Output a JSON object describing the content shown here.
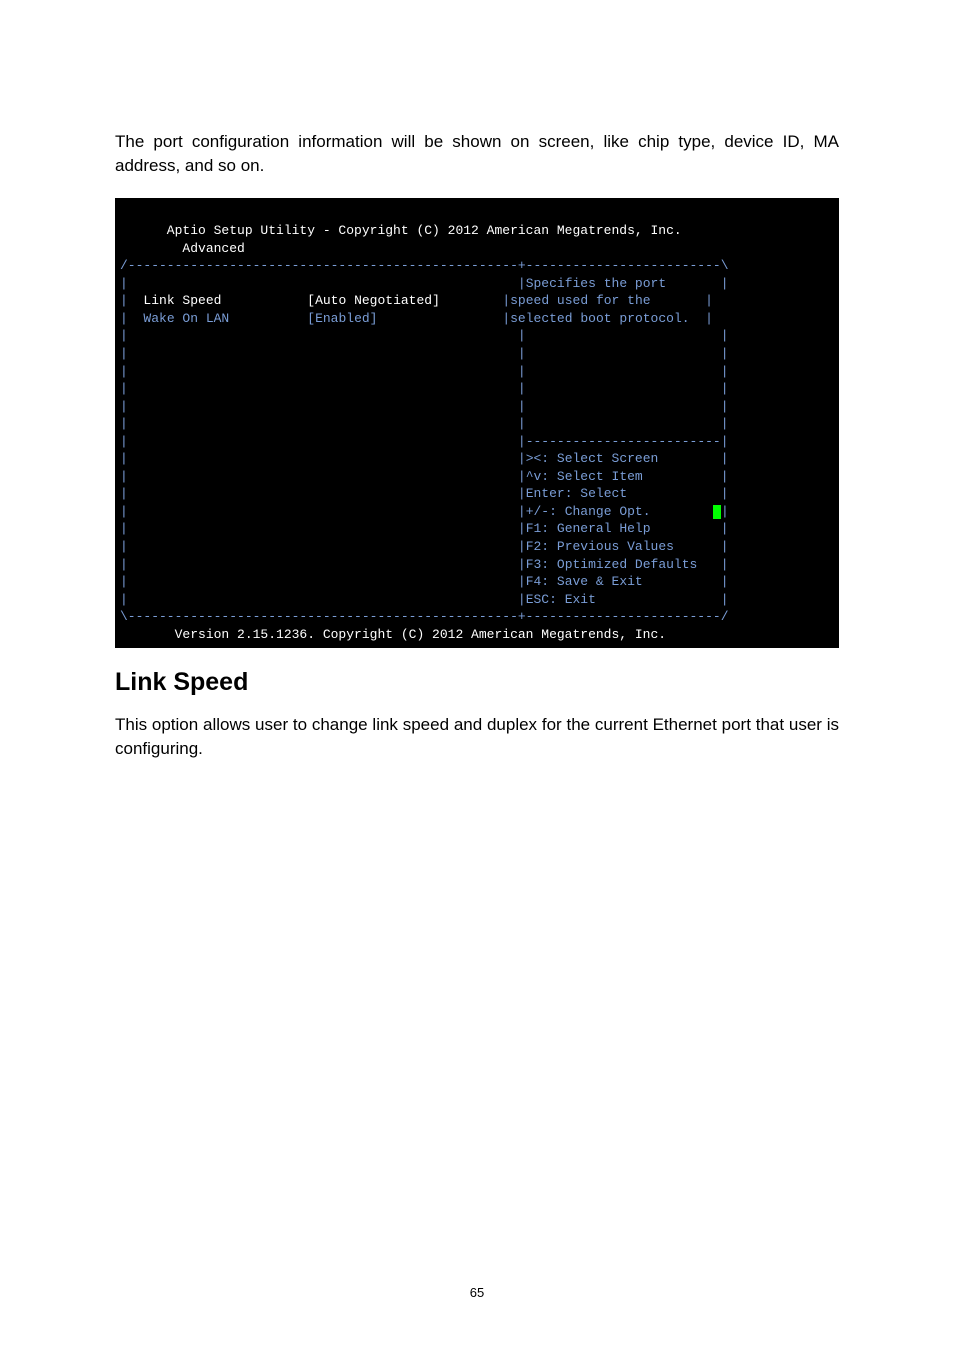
{
  "intro": "The port configuration information will be shown on screen, like chip type, device ID, MA address, and so on.",
  "bios": {
    "header": "      Aptio Setup Utility - Copyright (C) 2012 American Megatrends, Inc.",
    "tab": "        Advanced",
    "items": [
      {
        "label": "Link Speed",
        "value": "[Auto Negotiated]"
      },
      {
        "label": "Wake On LAN",
        "value": "[Enabled]"
      }
    ],
    "help_title": "Specifies the port",
    "help_l2": "speed used for the",
    "help_l3": "selected boot protocol.",
    "keys": [
      "><: Select Screen",
      "^v: Select Item",
      "Enter: Select",
      "+/-: Change Opt.",
      "F1: General Help",
      "F2: Previous Values",
      "F3: Optimized Defaults",
      "F4: Save & Exit",
      "ESC: Exit"
    ],
    "footer": "       Version 2.15.1236. Copyright (C) 2012 American Megatrends, Inc."
  },
  "section_title": "Link Speed",
  "section_body": "This option allows user to change link speed and duplex for the current Ethernet port that user is configuring.",
  "page_number": "65"
}
